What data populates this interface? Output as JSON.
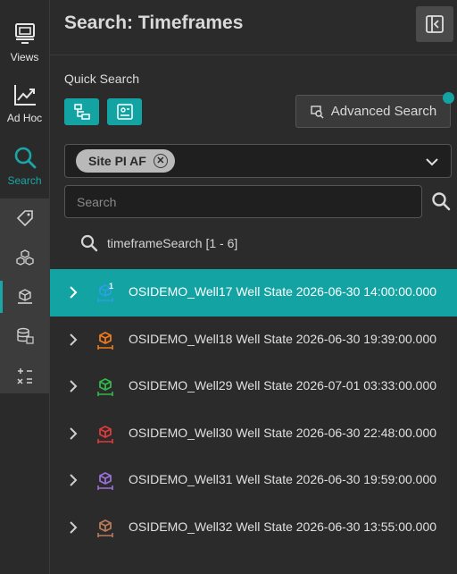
{
  "nav": {
    "items": [
      {
        "label": "Views",
        "icon": "views-icon"
      },
      {
        "label": "Ad Hoc",
        "icon": "trend-chart-icon"
      },
      {
        "label": "Search",
        "icon": "search-icon",
        "active": true
      }
    ],
    "sub_items": [
      {
        "icon": "tag-icon"
      },
      {
        "icon": "assets-icon"
      },
      {
        "icon": "event-frame-icon",
        "active": true
      },
      {
        "icon": "database-icon"
      },
      {
        "icon": "calculator-icon"
      }
    ]
  },
  "header": {
    "title": "Search: Timeframes",
    "collapse_icon": "collapse-panel-icon"
  },
  "quick_search": {
    "label": "Quick Search",
    "buttons": [
      {
        "icon": "hierarchy-icon"
      },
      {
        "icon": "attribute-template-icon"
      }
    ],
    "advanced_label": "Advanced Search"
  },
  "database_selector": {
    "chip_label": "Site PI AF",
    "chip_remove": "✕"
  },
  "search": {
    "placeholder": "Search",
    "value": ""
  },
  "results": {
    "header": "timeframeSearch [1 - 6]"
  },
  "rows": [
    {
      "label": "OSIDEMO_Well17 Well State 2026-06-30 14:00:00.000",
      "color": "#2aa0e0",
      "badge": "1",
      "selected": true
    },
    {
      "label": "OSIDEMO_Well18 Well State 2026-06-30 19:39:00.000",
      "color": "#f07a1a"
    },
    {
      "label": "OSIDEMO_Well29 Well State 2026-07-01 03:33:00.000",
      "color": "#33b84a"
    },
    {
      "label": "OSIDEMO_Well30 Well State 2026-06-30 22:48:00.000",
      "color": "#e03a3a"
    },
    {
      "label": "OSIDEMO_Well31 Well State 2026-06-30 19:59:00.000",
      "color": "#9a6fd8"
    },
    {
      "label": "OSIDEMO_Well32 Well State 2026-06-30 13:55:00.000",
      "color": "#b87a5a"
    }
  ],
  "colors": {
    "accent": "#14a3a3",
    "background": "#2b2b2b",
    "selected_text": "#ffffff"
  }
}
